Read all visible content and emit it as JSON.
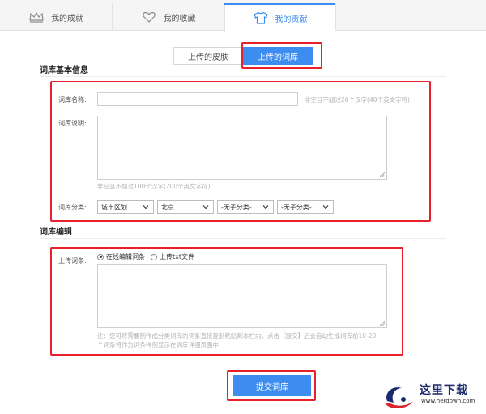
{
  "tabs": [
    {
      "label": "我的成就",
      "icon": "crown-icon"
    },
    {
      "label": "我的收藏",
      "icon": "heart-icon"
    },
    {
      "label": "我的贡献",
      "icon": "tshirt-icon",
      "active": true
    }
  ],
  "segments": {
    "skin": "上传的皮肤",
    "library": "上传的词库",
    "active": "library"
  },
  "basic_info": {
    "title": "词库基本信息",
    "name_label": "词库名称:",
    "name_value": "",
    "name_hint": "非空且不超过20个汉字(40个英文字符)",
    "desc_label": "词库说明:",
    "desc_value": "",
    "desc_hint": "非空且不超过100个汉字(200个英文字符)",
    "category_label": "词库分类:",
    "categories": [
      "城市区划",
      "北京",
      "-无子分类-",
      "-无子分类-"
    ]
  },
  "edit": {
    "title": "词库编辑",
    "upload_label": "上传词条:",
    "options": [
      "在线编辑词条",
      "上传txt文件"
    ],
    "selected_option": "在线编辑词条",
    "entries_value": "",
    "note_line1": "注：您可将需要制作成分类词库的词条直接复制粘贴到本栏内，点击【提交】后会自动生成词库前10-20",
    "note_line2": "个词条将作为词条样例显示在词库详细页面中"
  },
  "submit_label": "提交词库",
  "watermark": {
    "text": "这里下载",
    "url": "www.herdown.com"
  },
  "colors": {
    "accent": "#3d8cf0",
    "highlight": "#e8202a"
  }
}
